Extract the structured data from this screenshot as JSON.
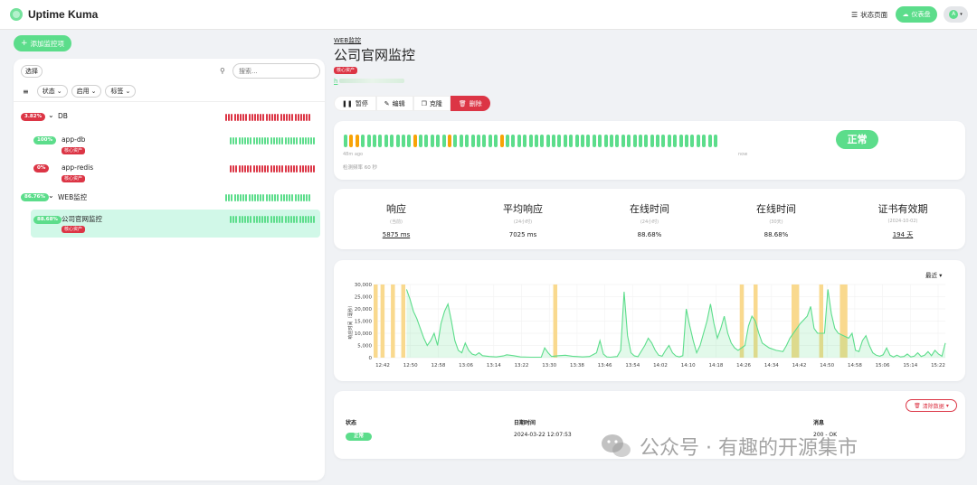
{
  "app": {
    "title": "Uptime Kuma"
  },
  "header": {
    "status_page_label": "状态页面",
    "dashboard_label": "仪表盘",
    "avatar_initial": "A"
  },
  "sidebar": {
    "add_button_label": "添加监控项",
    "select_label": "选择",
    "search_placeholder": "搜索...",
    "filters": [
      {
        "label": "状态"
      },
      {
        "label": "启用"
      },
      {
        "label": "标签"
      }
    ],
    "monitors": [
      {
        "uptime": "3.82%",
        "name": "DB",
        "is_group": true,
        "status": "down",
        "tag": ""
      },
      {
        "uptime": "100%",
        "name": "app-db",
        "is_group": false,
        "status": "up",
        "tag": "核心资产"
      },
      {
        "uptime": "0%",
        "name": "app-redis",
        "is_group": false,
        "status": "down",
        "tag": "核心资产"
      },
      {
        "uptime": "86.76%",
        "name": "WEB监控",
        "is_group": true,
        "status": "up",
        "tag": ""
      },
      {
        "uptime": "88.68%",
        "name": "公司官网监控",
        "is_group": false,
        "status": "up",
        "tag": "核心资产",
        "selected": true
      }
    ]
  },
  "detail": {
    "breadcrumb": "WEB监控",
    "title": "公司官网监控",
    "tag": "核心资产",
    "url_prefix": "h",
    "actions": [
      {
        "label": "暂停",
        "icon": "pause-icon"
      },
      {
        "label": "编辑",
        "icon": "edit-icon"
      },
      {
        "label": "克隆",
        "icon": "clone-icon"
      },
      {
        "label": "删除",
        "icon": "trash-icon"
      }
    ],
    "heartbeat": {
      "beats": [
        "up",
        "down",
        "down",
        "up",
        "up",
        "up",
        "up",
        "up",
        "up",
        "up",
        "up",
        "up",
        "down",
        "up",
        "up",
        "up",
        "up",
        "up",
        "down",
        "up",
        "up",
        "up",
        "up",
        "up",
        "up",
        "up",
        "up",
        "down",
        "up",
        "up",
        "up",
        "up",
        "up",
        "up",
        "up",
        "up",
        "up",
        "up",
        "up",
        "up",
        "up",
        "up",
        "up",
        "up",
        "up",
        "up",
        "up",
        "up",
        "up",
        "up",
        "up",
        "up",
        "up",
        "up",
        "up",
        "up",
        "up",
        "up",
        "up",
        "up",
        "up",
        "up",
        "up",
        "up",
        "up"
      ],
      "time_left": "48m ago",
      "time_right": "now",
      "interval_text": "检测频率 60 秒",
      "status": "正常"
    },
    "stats": [
      {
        "title": "响应",
        "sub": "(当前)",
        "value": "5875 ms",
        "underline": true
      },
      {
        "title": "平均响应",
        "sub": "(24小时)",
        "value": "7025 ms",
        "underline": false
      },
      {
        "title": "在线时间",
        "sub": "(24小时)",
        "value": "88.68%",
        "underline": false
      },
      {
        "title": "在线时间",
        "sub": "(30天)",
        "value": "88.68%",
        "underline": false
      },
      {
        "title": "证书有效期",
        "sub": "(2024-10-02)",
        "value": "194 天",
        "underline": true
      }
    ],
    "range_label": "最近"
  },
  "colors": {
    "up": "#5cdd8b",
    "down": "#dc3545",
    "pending": "#f8a306",
    "maintenance": "#f9d98e"
  },
  "chart_data": {
    "type": "line",
    "ylabel": "响应时间（毫秒）",
    "ylim": [
      0,
      30000
    ],
    "y_ticks": [
      "0",
      "5,000",
      "10,000",
      "15,000",
      "20,000",
      "25,000",
      "30,000"
    ],
    "x_ticks": [
      "12:42",
      "12:50",
      "12:58",
      "13:06",
      "13:14",
      "13:22",
      "13:30",
      "13:38",
      "13:46",
      "13:54",
      "14:02",
      "14:10",
      "14:18",
      "14:26",
      "14:34",
      "14:42",
      "14:50",
      "14:58",
      "15:06",
      "15:14",
      "15:22"
    ],
    "x_range_minutes": [
      0,
      165
    ],
    "down_minutes": [
      0,
      2,
      5,
      8,
      52,
      106,
      110,
      121,
      122,
      129,
      135,
      136
    ],
    "series": [
      {
        "points": [
          [
            9,
            28000
          ],
          [
            10,
            24000
          ],
          [
            11,
            19000
          ],
          [
            12,
            16000
          ],
          [
            13,
            12000
          ],
          [
            14,
            8000
          ],
          [
            15,
            5000
          ],
          [
            16,
            7000
          ],
          [
            17,
            10000
          ],
          [
            18,
            5000
          ],
          [
            19,
            14000
          ],
          [
            20,
            19000
          ],
          [
            21,
            22000
          ],
          [
            22,
            15000
          ],
          [
            23,
            7000
          ],
          [
            24,
            3000
          ],
          [
            25,
            2000
          ],
          [
            26,
            6000
          ],
          [
            27,
            3000
          ],
          [
            28,
            1500
          ],
          [
            29,
            1000
          ],
          [
            30,
            2000
          ],
          [
            31,
            800
          ],
          [
            33,
            500
          ],
          [
            35,
            300
          ],
          [
            37,
            700
          ],
          [
            38,
            1200
          ],
          [
            40,
            800
          ],
          [
            42,
            300
          ],
          [
            45,
            200
          ],
          [
            48,
            200
          ],
          [
            49,
            4000
          ],
          [
            50,
            2000
          ],
          [
            51,
            500
          ],
          [
            53,
            800
          ],
          [
            55,
            1000
          ],
          [
            57,
            600
          ],
          [
            60,
            300
          ],
          [
            62,
            500
          ],
          [
            64,
            2000
          ],
          [
            65,
            7000
          ],
          [
            66,
            1500
          ],
          [
            67,
            300
          ],
          [
            68,
            200
          ],
          [
            70,
            500
          ],
          [
            71,
            3000
          ],
          [
            72,
            27000
          ],
          [
            73,
            9000
          ],
          [
            74,
            2000
          ],
          [
            75,
            700
          ],
          [
            76,
            400
          ],
          [
            78,
            5000
          ],
          [
            79,
            8000
          ],
          [
            80,
            6000
          ],
          [
            81,
            3000
          ],
          [
            82,
            1000
          ],
          [
            83,
            600
          ],
          [
            84,
            3000
          ],
          [
            85,
            5000
          ],
          [
            86,
            2000
          ],
          [
            87,
            700
          ],
          [
            88,
            300
          ],
          [
            89,
            800
          ],
          [
            90,
            20000
          ],
          [
            91,
            13000
          ],
          [
            92,
            7000
          ],
          [
            93,
            2000
          ],
          [
            94,
            5000
          ],
          [
            95,
            10000
          ],
          [
            96,
            15000
          ],
          [
            97,
            22000
          ],
          [
            98,
            14000
          ],
          [
            99,
            8000
          ],
          [
            100,
            12000
          ],
          [
            101,
            17000
          ],
          [
            102,
            10000
          ],
          [
            103,
            6000
          ],
          [
            104,
            4000
          ],
          [
            105,
            3000
          ],
          [
            107,
            5000
          ],
          [
            108,
            13000
          ],
          [
            109,
            17000
          ],
          [
            110,
            15000
          ],
          [
            111,
            10000
          ],
          [
            112,
            6000
          ],
          [
            114,
            4000
          ],
          [
            116,
            3000
          ],
          [
            118,
            2500
          ],
          [
            119,
            5000
          ],
          [
            120,
            8000
          ],
          [
            123,
            14000
          ],
          [
            125,
            17000
          ],
          [
            126,
            21000
          ],
          [
            127,
            12000
          ],
          [
            128,
            10000
          ],
          [
            130,
            10000
          ],
          [
            131,
            28000
          ],
          [
            132,
            18000
          ],
          [
            133,
            12000
          ],
          [
            134,
            10000
          ],
          [
            137,
            8000
          ],
          [
            138,
            10000
          ],
          [
            139,
            3000
          ],
          [
            140,
            2500
          ],
          [
            141,
            7000
          ],
          [
            142,
            9000
          ],
          [
            143,
            5000
          ],
          [
            144,
            2000
          ],
          [
            145,
            1000
          ],
          [
            146,
            600
          ],
          [
            147,
            1200
          ],
          [
            148,
            4000
          ],
          [
            149,
            1000
          ],
          [
            150,
            300
          ],
          [
            151,
            1000
          ],
          [
            152,
            300
          ],
          [
            153,
            500
          ],
          [
            154,
            1500
          ],
          [
            155,
            300
          ],
          [
            156,
            600
          ],
          [
            157,
            2000
          ],
          [
            158,
            500
          ],
          [
            159,
            1000
          ],
          [
            160,
            2500
          ],
          [
            161,
            800
          ],
          [
            162,
            3000
          ],
          [
            163,
            1500
          ],
          [
            164,
            600
          ],
          [
            165,
            6000
          ]
        ]
      }
    ]
  },
  "events": {
    "clear_label": "清除数据",
    "headers": [
      "状态",
      "日期时间",
      "消息"
    ],
    "rows": [
      {
        "status": "正常",
        "datetime": "2024-03-22 12:07:53",
        "message": "200 - OK"
      }
    ]
  },
  "watermark": {
    "text": "公众号 · 有趣的开源集市"
  }
}
